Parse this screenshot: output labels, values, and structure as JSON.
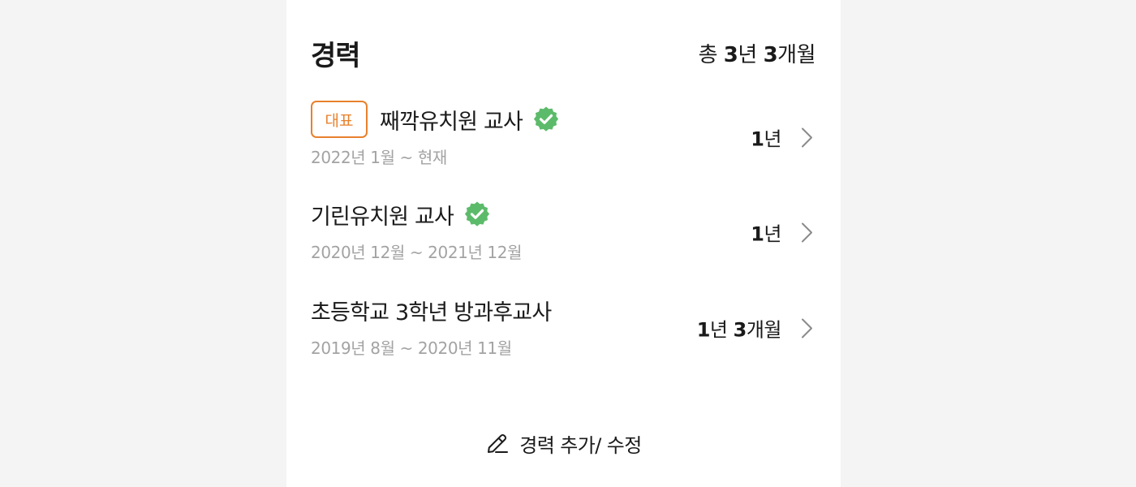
{
  "header": {
    "title": "경력",
    "total_prefix": "총 ",
    "total_years": "3",
    "total_years_unit": "년 ",
    "total_months": "3",
    "total_months_unit": "개월"
  },
  "careers": [
    {
      "badge": "대표",
      "title": "째깍유치원 교사",
      "verified": true,
      "period": "2022년 1월 ~ 현재",
      "duration_years": "1",
      "duration_years_unit": "년",
      "duration_months": "",
      "duration_months_unit": ""
    },
    {
      "badge": "",
      "title": "기린유치원 교사",
      "verified": true,
      "period": "2020년 12월 ~ 2021년 12월",
      "duration_years": "1",
      "duration_years_unit": "년",
      "duration_months": "",
      "duration_months_unit": ""
    },
    {
      "badge": "",
      "title": "초등학교 3학년 방과후교사",
      "verified": false,
      "period": "2019년 8월 ~ 2020년 11월",
      "duration_years": "1",
      "duration_years_unit": "년 ",
      "duration_months": "3",
      "duration_months_unit": "개월"
    }
  ],
  "footer": {
    "edit_label": "경력 추가/ 수정"
  },
  "icons": {
    "verified": "verified-check-icon",
    "chevron": "chevron-right-icon",
    "edit": "pencil-icon"
  },
  "colors": {
    "accent": "#e8812d",
    "verified": "#5cbb6a",
    "muted": "#a3a3a3",
    "background": "#f4f4f4"
  }
}
